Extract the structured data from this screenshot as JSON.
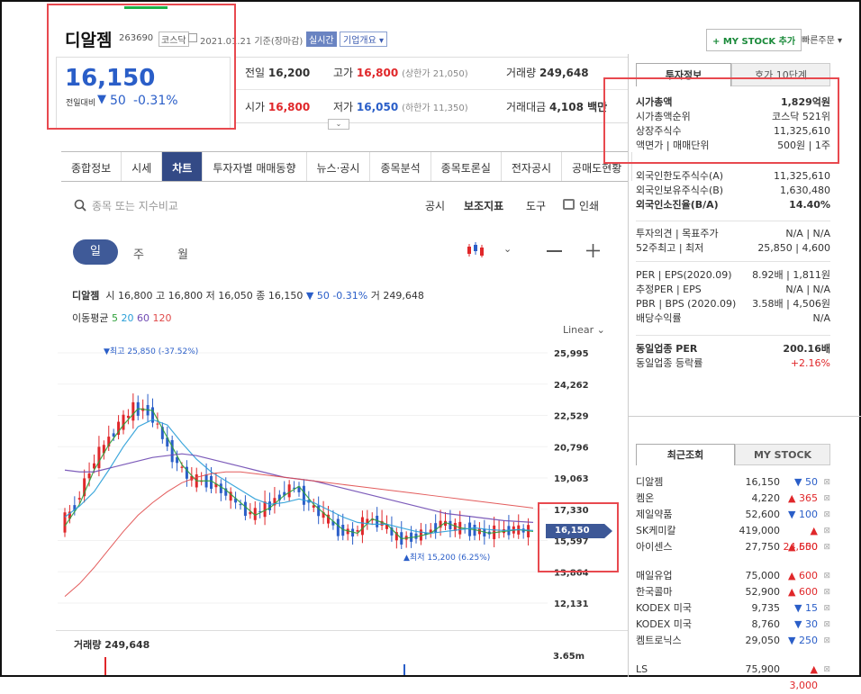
{
  "stock": {
    "name": "디알젬",
    "code": "263690",
    "market": "코스닥",
    "date_info": "2021.01.21 기준(장마감)",
    "realtime": "실시간",
    "company_overview": "기업개요",
    "price": "16,150",
    "change_label": "전일대비",
    "change": "50",
    "change_pct": "-0.31%"
  },
  "header_buttons": {
    "my_stock_add": "+ MY STOCK 추가",
    "quick_order": "빠른주문"
  },
  "quote": {
    "prev_close_label": "전일",
    "prev_close": "16,200",
    "high_label": "고가",
    "high": "16,800",
    "upper_limit": "(상한가 21,050)",
    "volume_label": "거래량",
    "volume": "249,648",
    "open_label": "시가",
    "open": "16,800",
    "low_label": "저가",
    "low": "16,050",
    "lower_limit": "(하한가 11,350)",
    "amount_label": "거래대금",
    "amount": "4,108 백만"
  },
  "tabs": [
    "종합정보",
    "시세",
    "차트",
    "투자자별 매매동향",
    "뉴스·공시",
    "종목분석",
    "종목토론실",
    "전자공시",
    "공매도현황"
  ],
  "chart_toolbar": {
    "search_placeholder": "종목 또는 지수비교",
    "disclosure": "공시",
    "indicator": "보조지표",
    "tools": "도구",
    "print": "인쇄",
    "period_day": "일",
    "period_week": "주",
    "period_month": "월"
  },
  "chart_info": {
    "name": "디알젬",
    "open_label": "시",
    "open": "16,800",
    "high_label": "고",
    "high": "16,800",
    "low_label": "저",
    "low": "16,050",
    "close_label": "종",
    "close": "16,150",
    "change": "▼ 50 -0.31%",
    "volume_label": "거",
    "volume": "249,648",
    "ma_label": "이동평균",
    "ma": [
      "5",
      "20",
      "60",
      "120"
    ],
    "scale": "Linear",
    "high_marker": "▼최고 25,850 (-37.52%)",
    "low_marker": "▲최저 15,200 (6.25%)",
    "price_tag": "16,150",
    "volume_title": "거래량 249,648",
    "volume_axis": "3.65m"
  },
  "chart_data": {
    "type": "line",
    "yticks": [
      "25,995",
      "24,262",
      "22,529",
      "20,796",
      "19,063",
      "17,330",
      "15,597",
      "13,864",
      "12,131"
    ],
    "ylim": [
      12131,
      25995
    ],
    "series": [
      {
        "values": [
          16400,
          17600,
          19500,
          20900,
          22000,
          22900,
          22800,
          21300,
          19800,
          18900,
          18900,
          18400,
          17700,
          17000,
          17400,
          18100,
          18600,
          17600,
          16900,
          16200,
          16000,
          16800,
          16500,
          15700,
          15800,
          16000,
          16600,
          16300,
          16200,
          16000,
          16100,
          16200,
          16100
        ]
      },
      {
        "values": [
          16900,
          17500,
          18300,
          19500,
          20800,
          21900,
          22300,
          22000,
          21000,
          20100,
          19400,
          18900,
          18400,
          17900,
          17600,
          17700,
          17900,
          17700,
          17300,
          16900,
          16600,
          16500,
          16500,
          16300,
          16100,
          16000,
          16100,
          16200,
          16300,
          16200,
          16150,
          16200,
          16150
        ]
      },
      {
        "values": [
          19500,
          19400,
          19400,
          19600,
          19800,
          20000,
          20200,
          20300,
          20400,
          20300,
          20100,
          19900,
          19700,
          19500,
          19300,
          19100,
          19000,
          18900,
          18700,
          18500,
          18300,
          18100,
          17900,
          17700,
          17500,
          17300,
          17100,
          17000,
          16900,
          16800,
          16700,
          16650,
          16600
        ]
      },
      {
        "values": [
          12500,
          13200,
          14100,
          15100,
          16100,
          17000,
          17700,
          18300,
          18800,
          19100,
          19300,
          19400,
          19400,
          19300,
          19200,
          19100,
          19000,
          18900,
          18800,
          18700,
          18600,
          18500,
          18400,
          18300,
          18200,
          18100,
          18000,
          17900,
          17800,
          17700,
          17600,
          17500,
          17400
        ]
      }
    ]
  },
  "colors": {
    "ma5": "#2fa03a",
    "ma20": "#2a9fd8",
    "ma60": "#6f4ab3",
    "ma120": "#e04a4a",
    "up": "#e0272a",
    "down": "#2a5ec8"
  },
  "right_tabs": {
    "invest_info": "투자정보",
    "order_book": "호가 10단계"
  },
  "invest_info": {
    "rows1": [
      {
        "label": "시가총액",
        "value": "1,829억원"
      },
      {
        "label": "시가총액순위",
        "value": "코스닥 521위"
      },
      {
        "label": "상장주식수",
        "value": "11,325,610"
      },
      {
        "label": "액면가 | 매매단위",
        "value": "500원 | 1주"
      }
    ],
    "rows2": [
      {
        "label": "외국인한도주식수(A)",
        "value": "11,325,610"
      },
      {
        "label": "외국인보유주식수(B)",
        "value": "1,630,480"
      },
      {
        "label": "외국인소진율(B/A)",
        "value": "14.40%"
      }
    ],
    "rows3": [
      {
        "label": "투자의견 | 목표주가",
        "value": "N/A | N/A"
      },
      {
        "label": "52주최고 | 최저",
        "value": "25,850 | 4,600"
      }
    ],
    "rows4": [
      {
        "label": "PER | EPS(2020.09)",
        "value": "8.92배 | 1,811원"
      },
      {
        "label": "추정PER | EPS",
        "value": "N/A | N/A"
      },
      {
        "label": "PBR | BPS (2020.09)",
        "value": "3.58배 | 4,506원"
      },
      {
        "label": "배당수익률",
        "value": "N/A"
      }
    ],
    "rows5": [
      {
        "label": "동일업종 PER",
        "value": "200.16배"
      },
      {
        "label": "동일업종 등락률",
        "value": "+2.16%"
      }
    ]
  },
  "recent_tabs": {
    "recent": "최근조회",
    "my_stock": "MY STOCK"
  },
  "recent": [
    {
      "name": "디알젬",
      "price": "16,150",
      "change": "50",
      "dir": "down"
    },
    {
      "name": "켐온",
      "price": "4,220",
      "change": "365",
      "dir": "up"
    },
    {
      "name": "제일약품",
      "price": "52,600",
      "change": "100",
      "dir": "down"
    },
    {
      "name": "SK케미칼",
      "price": "419,000",
      "change": "24,500",
      "dir": "up"
    },
    {
      "name": "아이센스",
      "price": "27,750",
      "change": "650",
      "dir": "up"
    },
    {
      "name": "매일유업",
      "price": "75,000",
      "change": "600",
      "dir": "up"
    },
    {
      "name": "한국콜마",
      "price": "52,900",
      "change": "600",
      "dir": "up"
    },
    {
      "name": "KODEX 미국",
      "price": "9,735",
      "change": "15",
      "dir": "down"
    },
    {
      "name": "KODEX 미국",
      "price": "8,760",
      "change": "30",
      "dir": "down"
    },
    {
      "name": "켐트로닉스",
      "price": "29,050",
      "change": "250",
      "dir": "down"
    },
    {
      "name": "LS",
      "price": "75,900",
      "change": "3,000",
      "dir": "up"
    }
  ]
}
